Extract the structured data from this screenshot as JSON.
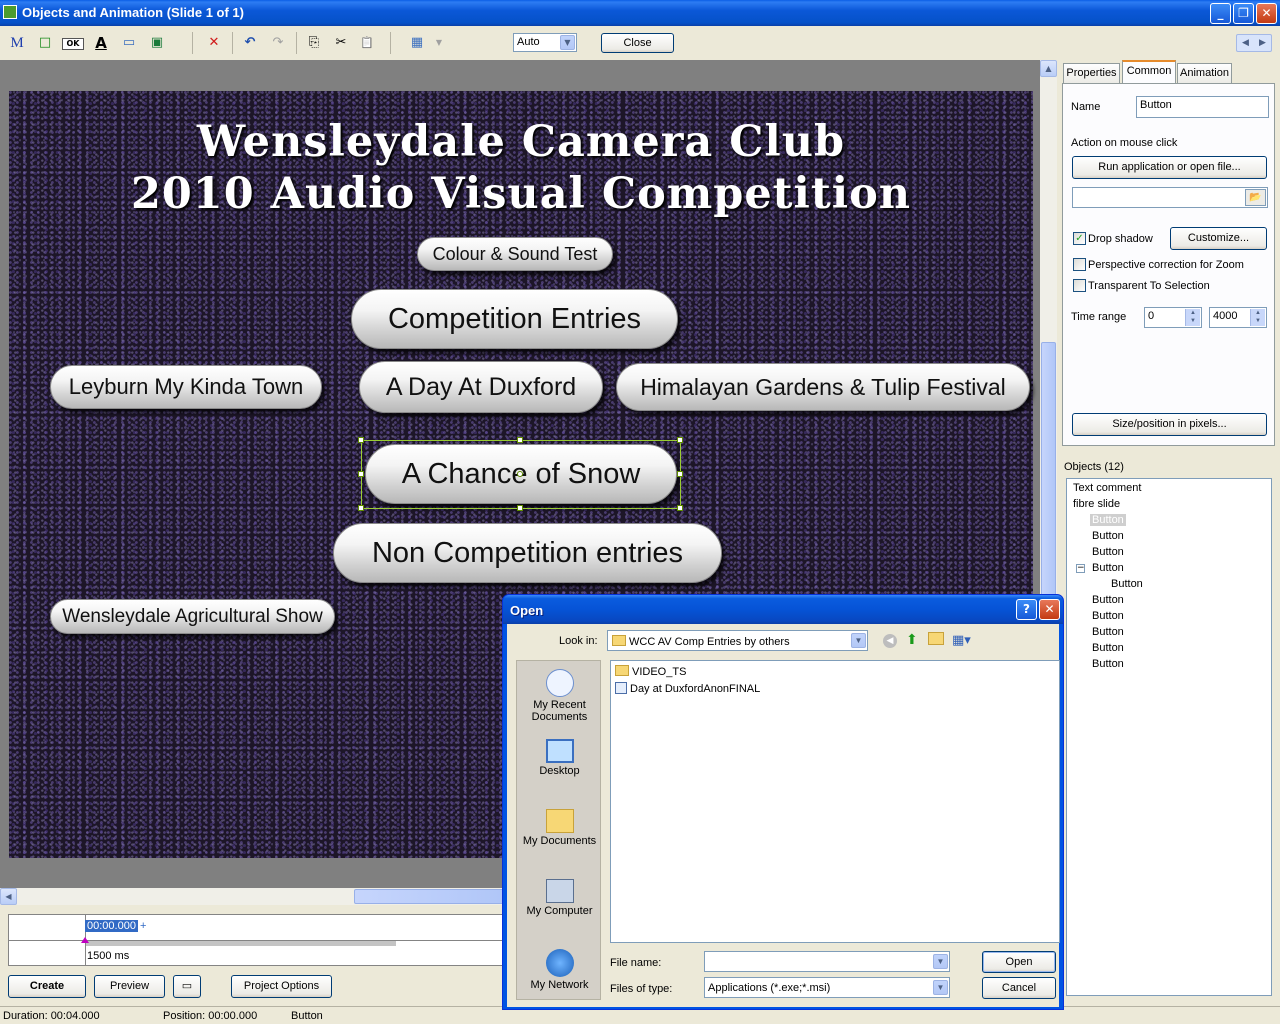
{
  "window": {
    "title": "Objects and Animation  (Slide 1 of 1)",
    "controls": [
      "_",
      "❐",
      "✕"
    ]
  },
  "toolbar": {
    "zoom_value": "Auto",
    "close_label": "Close",
    "nav_prev": "◀",
    "nav_next": "▶",
    "tools": {
      "text": "M",
      "rect": "□",
      "ok": "OK",
      "font": "A",
      "frame": "▭",
      "image": "▣",
      "delete": "✕",
      "undo": "↶",
      "redo": "↷",
      "copy": "⎘",
      "cut": "✂",
      "paste": "📋",
      "grid": "▦"
    }
  },
  "slide": {
    "title_line1": "Wensleydale Camera Club",
    "title_line2": "2010 Audio Visual Competition",
    "buttons": [
      "Colour & Sound Test",
      "Competition Entries",
      "Leyburn My Kinda Town",
      "A Day At Duxford",
      "Himalayan Gardens & Tulip Festival",
      "A Chance of Snow",
      "Non Competition entries",
      "Wensleydale Agricultural Show"
    ]
  },
  "timeline": {
    "position": "00:00.000",
    "plus": "+",
    "duration_label": "1500 ms"
  },
  "bottom_buttons": {
    "create": "Create",
    "preview": "Preview",
    "project_options": "Project Options"
  },
  "status": {
    "duration": "Duration:  00:04.000",
    "position": "Position:  00:00.000",
    "object": "Button"
  },
  "panel": {
    "tabs": [
      "Properties",
      "Common",
      "Animation"
    ],
    "active_tab": "Common",
    "name_label": "Name",
    "name_value": "Button",
    "action_label": "Action on mouse click",
    "action_button": "Run application or open file...",
    "path_value": "",
    "drop_shadow_label": "Drop shadow",
    "drop_shadow_checked": true,
    "customize_label": "Customize...",
    "perspective_label": "Perspective correction for Zoom",
    "perspective_checked": false,
    "transparent_label": "Transparent To Selection",
    "transparent_checked": false,
    "time_range_label": "Time range",
    "time_from": "0",
    "time_to": "4000",
    "size_button": "Size/position in pixels..."
  },
  "objects": {
    "header": "Objects (12)",
    "items": [
      "Text comment",
      "fibre slide",
      "Button",
      "Button",
      "Button",
      "Button",
      "Button",
      "Button",
      "Button",
      "Button",
      "Button",
      "Button"
    ],
    "expander": "−"
  },
  "open_dialog": {
    "title": "Open",
    "help": "?",
    "close": "✕",
    "look_in_label": "Look in:",
    "look_in_value": "WCC AV Comp Entries by others",
    "places": [
      "My Recent Documents",
      "Desktop",
      "My Documents",
      "My Computer",
      "My Network"
    ],
    "files": [
      "VIDEO_TS",
      "Day at DuxfordAnonFINAL"
    ],
    "file_name_label": "File name:",
    "file_name_value": "",
    "file_type_label": "Files of type:",
    "file_type_value": "Applications (*.exe;*.msi)",
    "open_label": "Open",
    "cancel_label": "Cancel"
  },
  "colors": {
    "xp_blue": "#0054e3",
    "selection_green": "#9acd32",
    "slide_bg": "#1d1628"
  }
}
